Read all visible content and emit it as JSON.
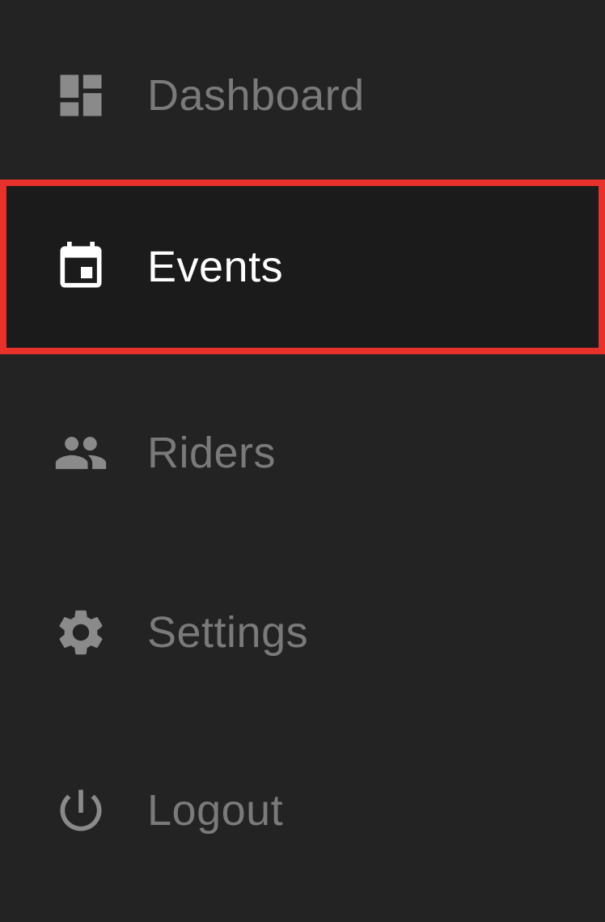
{
  "nav": {
    "items": [
      {
        "id": "dashboard",
        "label": "Dashboard",
        "icon": "dashboard-icon",
        "active": false
      },
      {
        "id": "events",
        "label": "Events",
        "icon": "calendar-icon",
        "active": true
      },
      {
        "id": "riders",
        "label": "Riders",
        "icon": "people-icon",
        "active": false
      },
      {
        "id": "settings",
        "label": "Settings",
        "icon": "gear-icon",
        "active": false
      },
      {
        "id": "logout",
        "label": "Logout",
        "icon": "power-icon",
        "active": false
      }
    ]
  },
  "colors": {
    "background": "#232323",
    "active_background": "#1b1b1b",
    "highlight_border": "#e8312a",
    "inactive_text": "#7a7a7a",
    "active_text": "#ffffff"
  }
}
